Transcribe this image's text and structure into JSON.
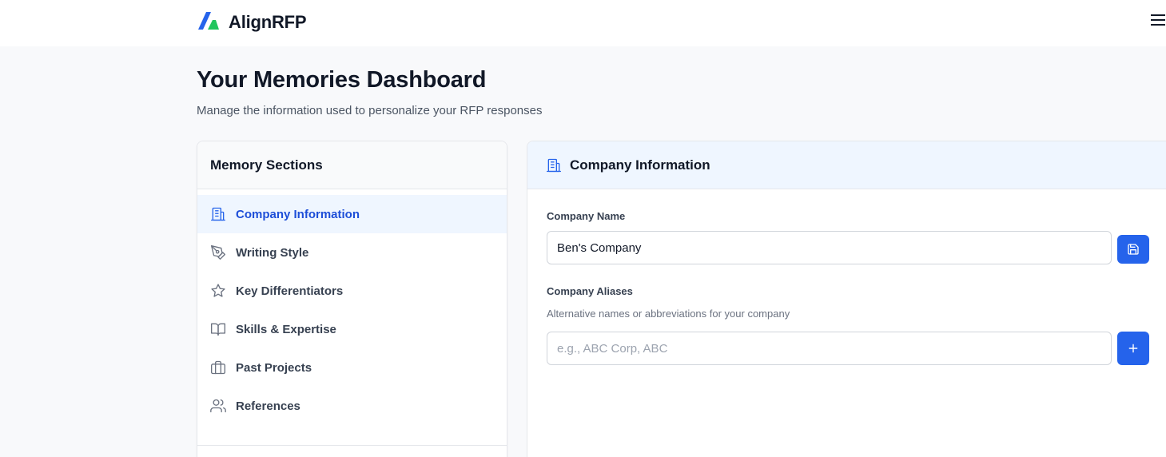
{
  "app": {
    "brand_name": "AlignRFP",
    "accent_color": "#2563eb"
  },
  "header": {
    "title": "Your Memories Dashboard",
    "subtitle": "Manage the information used to personalize your RFP responses"
  },
  "sidebar": {
    "title": "Memory Sections",
    "items": [
      {
        "label": "Company Information",
        "icon": "building-icon",
        "active": true
      },
      {
        "label": "Writing Style",
        "icon": "pen-tool-icon",
        "active": false
      },
      {
        "label": "Key Differentiators",
        "icon": "star-icon",
        "active": false
      },
      {
        "label": "Skills & Expertise",
        "icon": "book-open-icon",
        "active": false
      },
      {
        "label": "Past Projects",
        "icon": "briefcase-icon",
        "active": false
      },
      {
        "label": "References",
        "icon": "users-icon",
        "active": false
      }
    ]
  },
  "main": {
    "title": "Company Information",
    "company_name": {
      "label": "Company Name",
      "value": "Ben's Company",
      "action_icon": "save-icon"
    },
    "aliases": {
      "label": "Company Aliases",
      "help": "Alternative names or abbreviations for your company",
      "placeholder": "e.g., ABC Corp, ABC",
      "value": "",
      "action_icon": "plus-icon"
    }
  }
}
